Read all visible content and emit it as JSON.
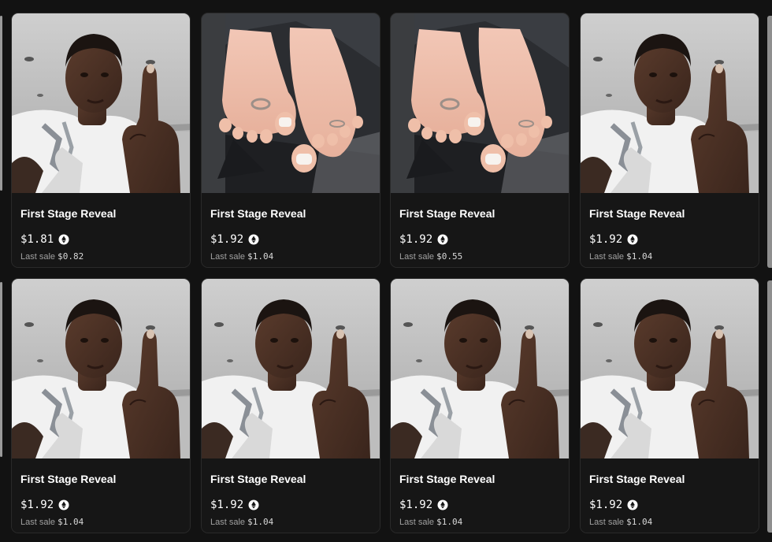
{
  "grid": {
    "cards": [
      {
        "title": "First Stage Reveal",
        "price": "$1.81",
        "last_sale_label": "Last sale",
        "last_sale_value": "$0.82",
        "image": "man-gesture-photo"
      },
      {
        "title": "First Stage Reveal",
        "price": "$1.92",
        "last_sale_label": "Last sale",
        "last_sale_value": "$1.04",
        "image": "feet-photo"
      },
      {
        "title": "First Stage Reveal",
        "price": "$1.92",
        "last_sale_label": "Last sale",
        "last_sale_value": "$0.55",
        "image": "feet-photo"
      },
      {
        "title": "First Stage Reveal",
        "price": "$1.92",
        "last_sale_label": "Last sale",
        "last_sale_value": "$1.04",
        "image": "man-gesture-photo"
      },
      {
        "title": "First Stage Reveal",
        "price": "$1.92",
        "last_sale_label": "Last sale",
        "last_sale_value": "$1.04",
        "image": "man-gesture-photo"
      },
      {
        "title": "First Stage Reveal",
        "price": "$1.92",
        "last_sale_label": "Last sale",
        "last_sale_value": "$1.04",
        "image": "man-gesture-photo"
      },
      {
        "title": "First Stage Reveal",
        "price": "$1.92",
        "last_sale_label": "Last sale",
        "last_sale_value": "$1.04",
        "image": "man-gesture-photo"
      },
      {
        "title": "First Stage Reveal",
        "price": "$1.92",
        "last_sale_label": "Last sale",
        "last_sale_value": "$1.04",
        "image": "man-gesture-photo"
      }
    ],
    "currency_icon": "ethereum-coin-icon"
  },
  "colors": {
    "background": "#121212",
    "card": "#161616",
    "text_primary": "#ffffff",
    "text_muted": "#a0a0a0"
  }
}
